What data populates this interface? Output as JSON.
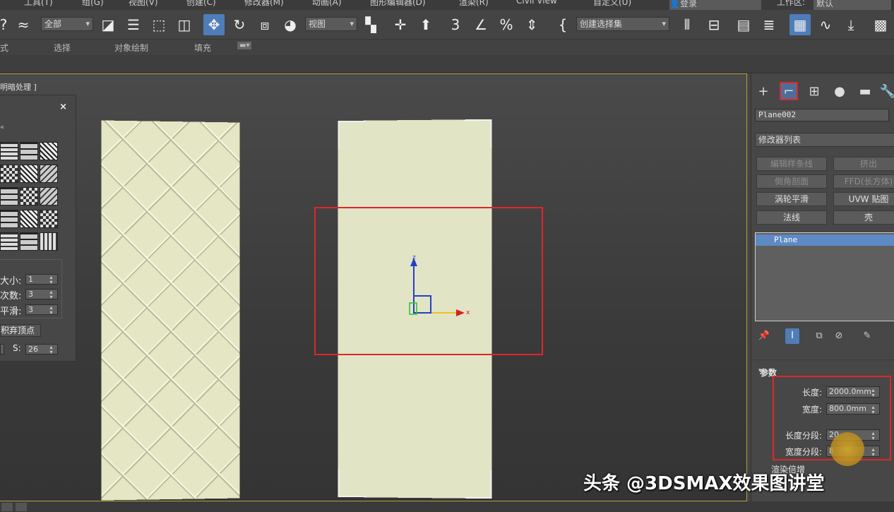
{
  "menubar": {
    "items": [
      "工具(T)",
      "组(G)",
      "视图(V)",
      "创建(C)",
      "修改器(M)",
      "动画(A)",
      "图形编辑器(D)",
      "渲染(R)",
      "Civil View",
      "自定义(U)"
    ],
    "login": "登录",
    "workspace_label": "工作区:",
    "workspace_value": "默认"
  },
  "toolbar": {
    "filter_value": "全部",
    "ref_coord_value": "视图",
    "selection_set_placeholder": "创建选择集"
  },
  "ribbon": {
    "tabs": [
      "式",
      "选择",
      "对象绘制",
      "填充"
    ]
  },
  "viewport": {
    "label": "明暗处理 ]"
  },
  "palette": {
    "close_icon": "×",
    "size_label": "大小:",
    "size_value": "1",
    "iterations_label": "次数:",
    "iterations_value": "3",
    "smooth_label": "平滑:",
    "smooth_value": "3",
    "discard_vertex_label": "积弃顶点",
    "s_label": "S:",
    "s_value": "26"
  },
  "command_panel": {
    "object_name": "Plane002",
    "modifier_list": "修改器列表",
    "modifier_buttons": [
      {
        "label": "编辑样条线",
        "enabled": false
      },
      {
        "label": "挤出",
        "enabled": false
      },
      {
        "label": "倒角剖面",
        "enabled": false
      },
      {
        "label": "FFD(长方体)",
        "enabled": false
      },
      {
        "label": "涡轮平滑",
        "enabled": true
      },
      {
        "label": "UVW 贴图",
        "enabled": true
      },
      {
        "label": "法线",
        "enabled": true
      },
      {
        "label": "壳",
        "enabled": true
      }
    ],
    "stack_item": "Plane",
    "params_header": "参数",
    "length_label": "长度:",
    "length_value": "2000.0mm",
    "width_label": "宽度:",
    "width_value": "800.0mm",
    "length_segs_label": "长度分段:",
    "length_segs_value": "20",
    "width_segs_label": "宽度分段:",
    "width_segs_value": "8",
    "render_label": "渲染倍增"
  },
  "watermark": "头条 @3DSMAX效果图讲堂",
  "colors": {
    "highlight": "#e0262a",
    "accent": "#4e7db8",
    "viewport_border": "#b5a33b"
  }
}
